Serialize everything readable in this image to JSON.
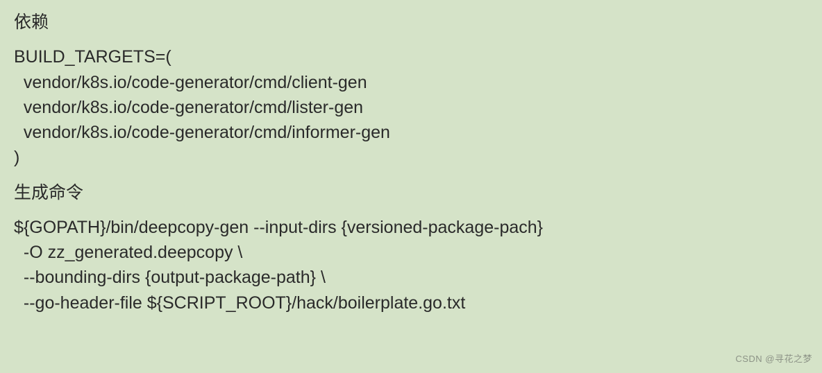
{
  "sections": {
    "deps_heading": "依赖",
    "build_targets": {
      "open": "BUILD_TARGETS=(",
      "item1": "  vendor/k8s.io/code-generator/cmd/client-gen",
      "item2": "  vendor/k8s.io/code-generator/cmd/lister-gen",
      "item3": "  vendor/k8s.io/code-generator/cmd/informer-gen",
      "close": ")"
    },
    "gen_heading": "生成命令",
    "gen_cmd": {
      "l1": "${GOPATH}/bin/deepcopy-gen --input-dirs {versioned-package-pach}",
      "l2": "  -O zz_generated.deepcopy \\",
      "l3": "  --bounding-dirs {output-package-path} \\",
      "l4": "  --go-header-file ${SCRIPT_ROOT}/hack/boilerplate.go.txt"
    }
  },
  "watermark": "CSDN @寻花之梦"
}
